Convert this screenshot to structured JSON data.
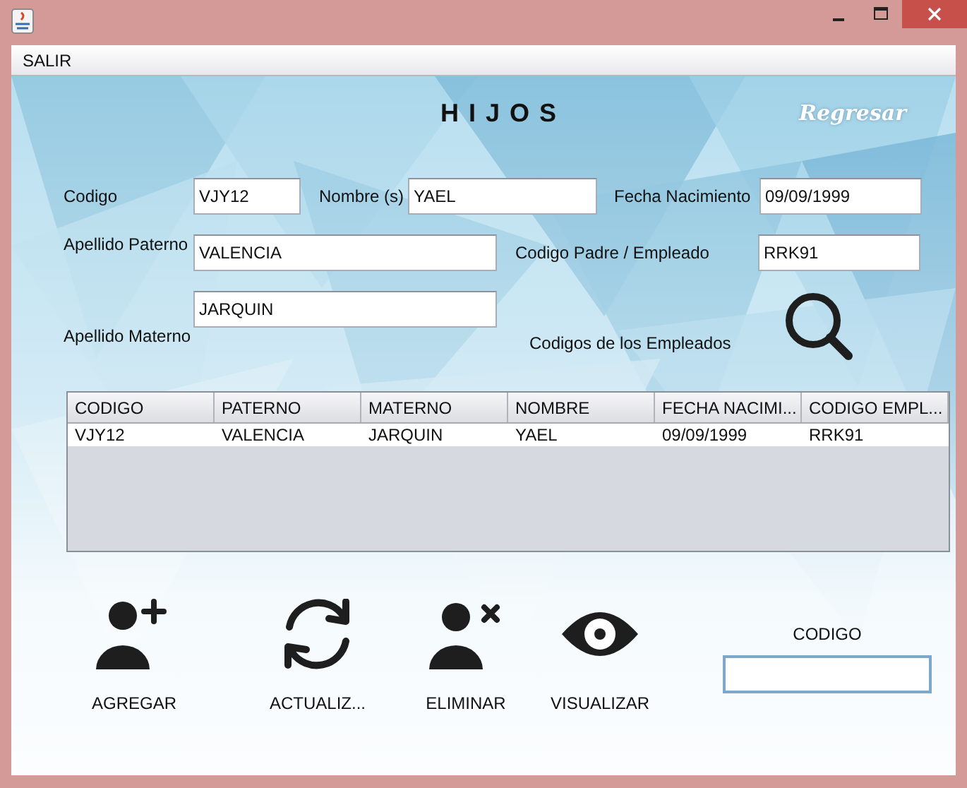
{
  "menu": [
    {
      "label": "SALIR"
    }
  ],
  "title": "H I J O S",
  "back_link": "Regresar",
  "fields": [
    {
      "label": "Codigo",
      "value": "VJY12"
    },
    {
      "label": "Nombre (s)",
      "value": "YAEL"
    },
    {
      "label": "Fecha Nacimiento",
      "value": "09/09/1999"
    },
    {
      "label": "Apellido Paterno",
      "value": "VALENCIA"
    },
    {
      "label": "Codigo Padre / Empleado",
      "value": "RRK91"
    },
    {
      "label": "Apellido Materno",
      "value": "JARQUIN"
    }
  ],
  "lookup": {
    "label": "Codigos de los Empleados"
  },
  "table": {
    "columns": [
      "CODIGO",
      "PATERNO",
      "MATERNO",
      "NOMBRE",
      "FECHA NACIMI...",
      "CODIGO EMPL..."
    ],
    "rows": [
      [
        "VJY12",
        "VALENCIA",
        "JARQUIN",
        "YAEL",
        "09/09/1999",
        "RRK91"
      ]
    ]
  },
  "actions": [
    {
      "label": "AGREGAR",
      "kind": "add-person"
    },
    {
      "label": "ACTUALIZ...",
      "kind": "refresh"
    },
    {
      "label": "ELIMINAR",
      "kind": "remove-person"
    },
    {
      "label": "VISUALIZAR",
      "kind": "view"
    }
  ],
  "search": {
    "label": "CODIGO",
    "focused": true
  }
}
